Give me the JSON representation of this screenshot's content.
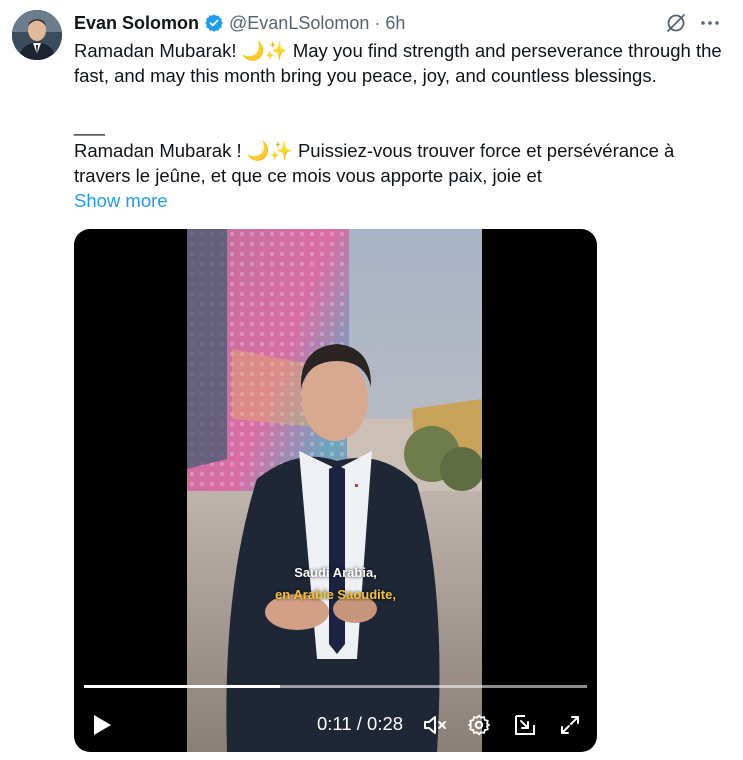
{
  "tweet": {
    "author_name": "Evan Solomon",
    "handle": "@EvanLSolomon",
    "separator": "·",
    "timestamp": "6h",
    "text": "Ramadan Mubarak! 🌙✨ May you find strength and perseverance through the fast, and may this month bring you peace, joy, and countless blessings.\n\n___\nRamadan Mubarak ! 🌙✨ Puissiez-vous trouver force et persévérance à travers le jeûne, et que ce mois vous apporte paix, joie et",
    "show_more": "Show more"
  },
  "video": {
    "caption_line1": "Saudi Arabia,",
    "caption_line2": "en Arabie Saoudite,",
    "time_display": "0:11 / 0:28",
    "progress_percent": 39
  },
  "colors": {
    "accent": "#1d9bf0",
    "verified": "#1d9bf0",
    "caption_highlight": "#f4c430"
  },
  "icons": [
    "verified-badge-icon",
    "grok-icon",
    "more-options-icon",
    "play-icon",
    "mute-icon",
    "settings-icon",
    "picture-in-picture-icon",
    "fullscreen-icon"
  ]
}
